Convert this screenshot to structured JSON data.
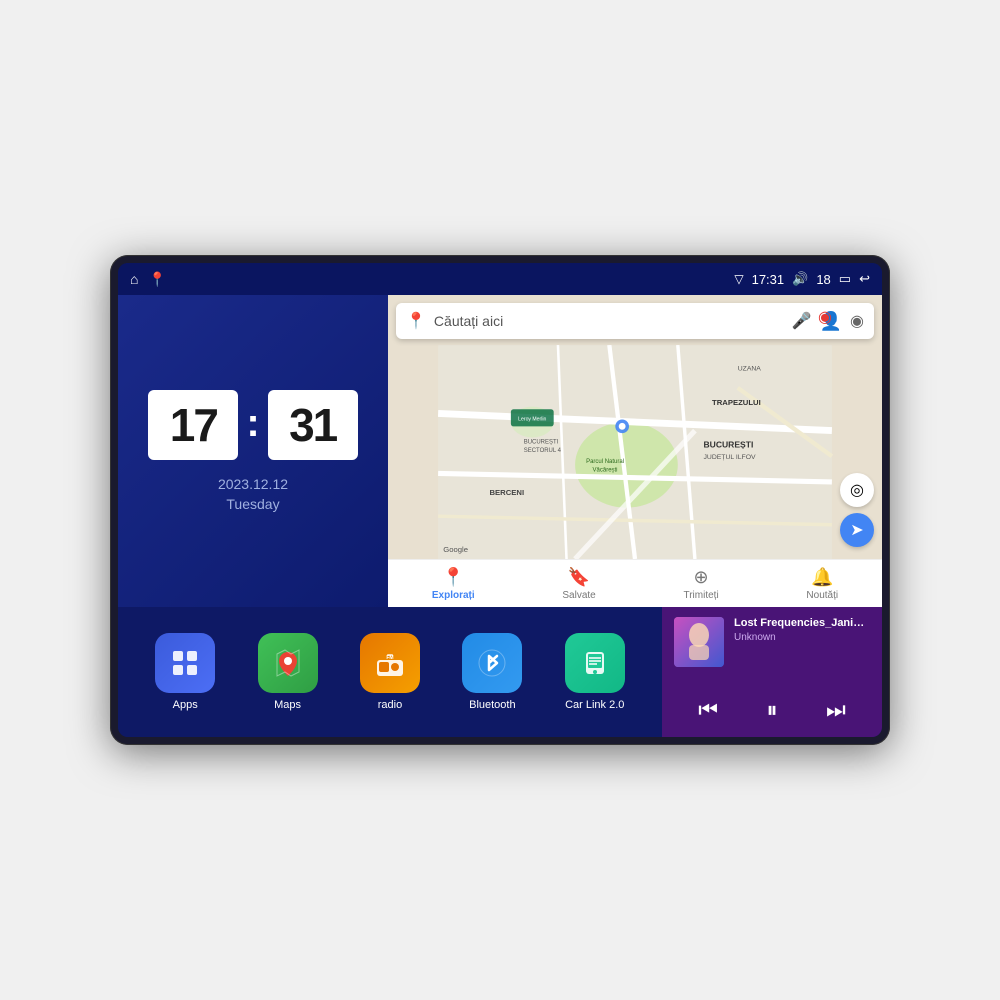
{
  "device": {
    "screen_bg": "#0d1b6e"
  },
  "status_bar": {
    "left_icons": [
      "home",
      "location"
    ],
    "time": "17:31",
    "volume_icon": "🔊",
    "volume_level": "18",
    "battery_icon": "🔋",
    "back_icon": "↩"
  },
  "clock": {
    "hours": "17",
    "minutes": "31",
    "date": "2023.12.12",
    "day": "Tuesday"
  },
  "map": {
    "search_placeholder": "Căutați aici",
    "location_pin": "📍",
    "nav_items": [
      {
        "label": "Explorați",
        "icon": "📍",
        "active": true
      },
      {
        "label": "Salvate",
        "icon": "🔖",
        "active": false
      },
      {
        "label": "Trimiteți",
        "icon": "⊕",
        "active": false
      },
      {
        "label": "Noutăți",
        "icon": "🔔",
        "active": false
      }
    ],
    "labels": {
      "parcul": "Parcul Natural Văcărești",
      "leroy": "Leroy Merlin",
      "bucuresti": "BUCUREȘTI",
      "judet": "JUDEȚUL ILFOV",
      "sector4": "BUCUREȘTI\nSECTORUL 4",
      "berceni": "BERCENI",
      "trapezului": "TRAPEZULUI",
      "uzana": "UZANA"
    }
  },
  "apps": [
    {
      "id": "apps",
      "label": "Apps",
      "icon": "⊞",
      "class": "icon-apps"
    },
    {
      "id": "maps",
      "label": "Maps",
      "icon": "🗺",
      "class": "icon-maps"
    },
    {
      "id": "radio",
      "label": "radio",
      "icon": "📻",
      "class": "icon-radio"
    },
    {
      "id": "bluetooth",
      "label": "Bluetooth",
      "icon": "🔷",
      "class": "icon-bluetooth"
    },
    {
      "id": "carlink",
      "label": "Car Link 2.0",
      "icon": "📱",
      "class": "icon-carlink"
    }
  ],
  "music": {
    "title": "Lost Frequencies_Janieck Devy-...",
    "artist": "Unknown",
    "controls": {
      "prev": "⏮",
      "play": "⏸",
      "next": "⏭"
    }
  }
}
